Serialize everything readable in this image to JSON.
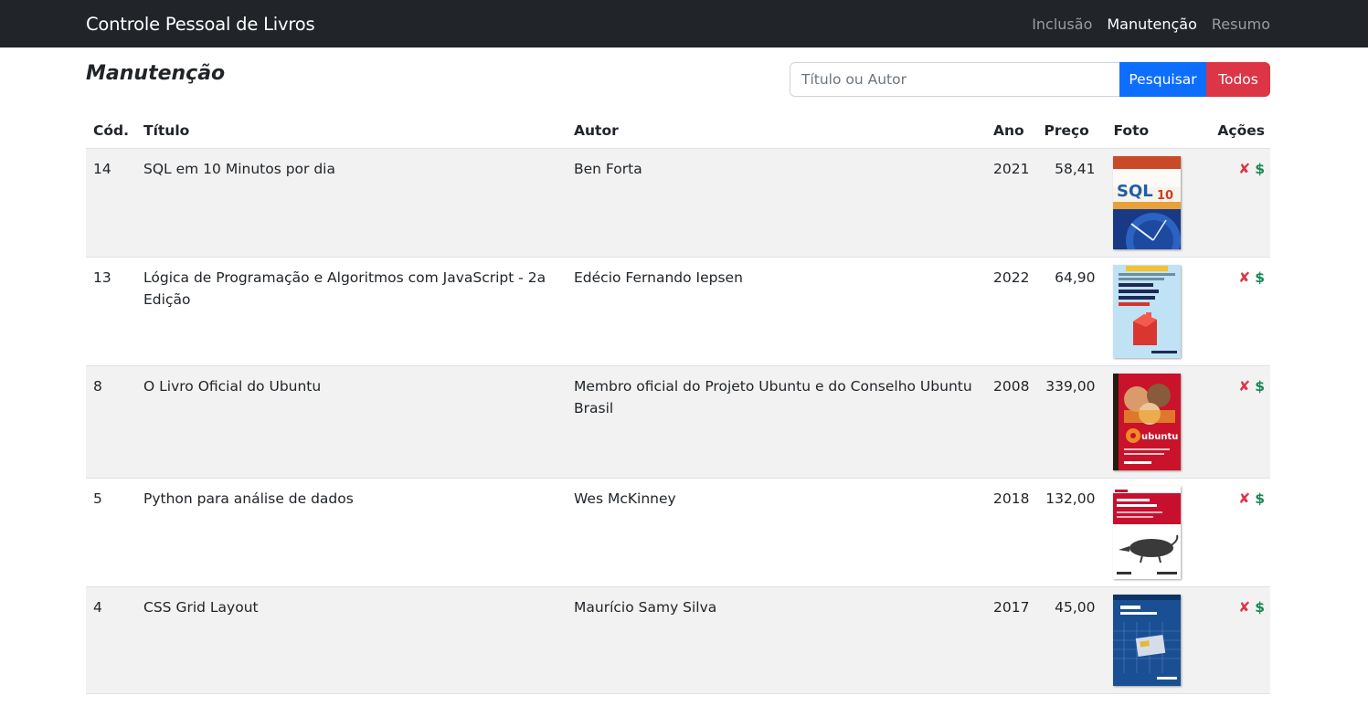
{
  "navbar": {
    "brand": "Controle Pessoal de Livros",
    "links": [
      {
        "label": "Inclusão",
        "active": false
      },
      {
        "label": "Manutenção",
        "active": true
      },
      {
        "label": "Resumo",
        "active": false
      }
    ]
  },
  "page": {
    "title": "Manutenção",
    "search_placeholder": "Título ou Autor",
    "search_button": "Pesquisar",
    "all_button": "Todos"
  },
  "table": {
    "headers": {
      "cod": "Cód.",
      "title": "Título",
      "author": "Autor",
      "year": "Ano",
      "price": "Preço",
      "photo": "Foto",
      "actions": "Ações"
    },
    "action_delete": "✘",
    "action_price": "$",
    "rows": [
      {
        "cod": "14",
        "title": "SQL em 10 Minutos por dia",
        "author": "Ben Forta",
        "year": "2021",
        "price": "58,41"
      },
      {
        "cod": "13",
        "title": "Lógica de Programação e Algoritmos com JavaScript - 2a Edição",
        "author": "Edécio Fernando Iepsen",
        "year": "2022",
        "price": "64,90"
      },
      {
        "cod": "8",
        "title": "O Livro Oficial do Ubuntu",
        "author": "Membro oficial do Projeto Ubuntu e do Conselho Ubuntu Brasil",
        "year": "2008",
        "price": "339,00"
      },
      {
        "cod": "5",
        "title": "Python para análise de dados",
        "author": "Wes McKinney",
        "year": "2018",
        "price": "132,00"
      },
      {
        "cod": "4",
        "title": "CSS Grid Layout",
        "author": "Maurício Samy Silva",
        "year": "2017",
        "price": "45,00"
      }
    ]
  },
  "colors": {
    "navbar_bg": "#212529",
    "primary": "#0d6efd",
    "danger": "#dc3545",
    "success": "#198754",
    "stripe": "#f2f2f2"
  },
  "icons": {
    "delete": "x-mark-icon",
    "price": "dollar-icon"
  }
}
